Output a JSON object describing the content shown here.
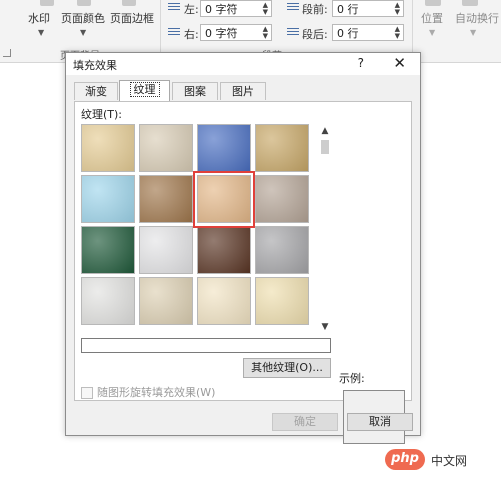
{
  "ribbon": {
    "watermark_label": "水印",
    "page_color_label": "页面颜色",
    "page_border_label": "页面边框",
    "page_bg_group": "页面背景",
    "indent_left_label": "左:",
    "indent_left_value": "0 字符",
    "indent_right_label": "右:",
    "indent_right_value": "0 字符",
    "spacing_before_label": "段前:",
    "spacing_before_value": "0 行",
    "spacing_after_label": "段后:",
    "spacing_after_value": "0 行",
    "paragraph_group": "段落",
    "position_label": "位置",
    "wrap_label": "自动换行"
  },
  "dialog": {
    "title": "填充效果",
    "help": "?",
    "close": "✕",
    "tabs": [
      {
        "label": "渐变",
        "active": false
      },
      {
        "label": "纹理",
        "active": true
      },
      {
        "label": "图案",
        "active": false
      },
      {
        "label": "图片",
        "active": false
      }
    ],
    "texture_label": "纹理(T):",
    "selected_texture_index": 6,
    "textures": [
      {
        "name": "纸莎草纸",
        "color": "#e6cd95"
      },
      {
        "name": "画布",
        "color": "#d9cdb6"
      },
      {
        "name": "斜纹布",
        "color": "#4a6fc2"
      },
      {
        "name": "编织物",
        "color": "#c8a868"
      },
      {
        "name": "水滴",
        "color": "#9fd6ec"
      },
      {
        "name": "纸袋",
        "color": "#a0774c"
      },
      {
        "name": "鱼类化石",
        "color": "#e4b889"
      },
      {
        "name": "沙滩",
        "color": "#b5a597"
      },
      {
        "name": "绿色大理石",
        "color": "#1f5a3a"
      },
      {
        "name": "白色大理石",
        "color": "#e4e4e6"
      },
      {
        "name": "棕色大理石",
        "color": "#5a3524"
      },
      {
        "name": "花岗岩",
        "color": "#a6a6a9"
      },
      {
        "name": "新闻纸",
        "color": "#e2e2e0"
      },
      {
        "name": "再生纸",
        "color": "#ddd0b3"
      },
      {
        "name": "羊皮纸",
        "color": "#f2e4c4"
      },
      {
        "name": "信纸",
        "color": "#efdfaf"
      }
    ],
    "other_texture_button": "其他纹理(O)...",
    "rotate_checkbox": "随图形旋转填充效果(W)",
    "sample_label": "示例:",
    "ok_button": "确定",
    "cancel_button": "取消"
  },
  "watermark": {
    "logo": "php",
    "text": "中文网"
  }
}
